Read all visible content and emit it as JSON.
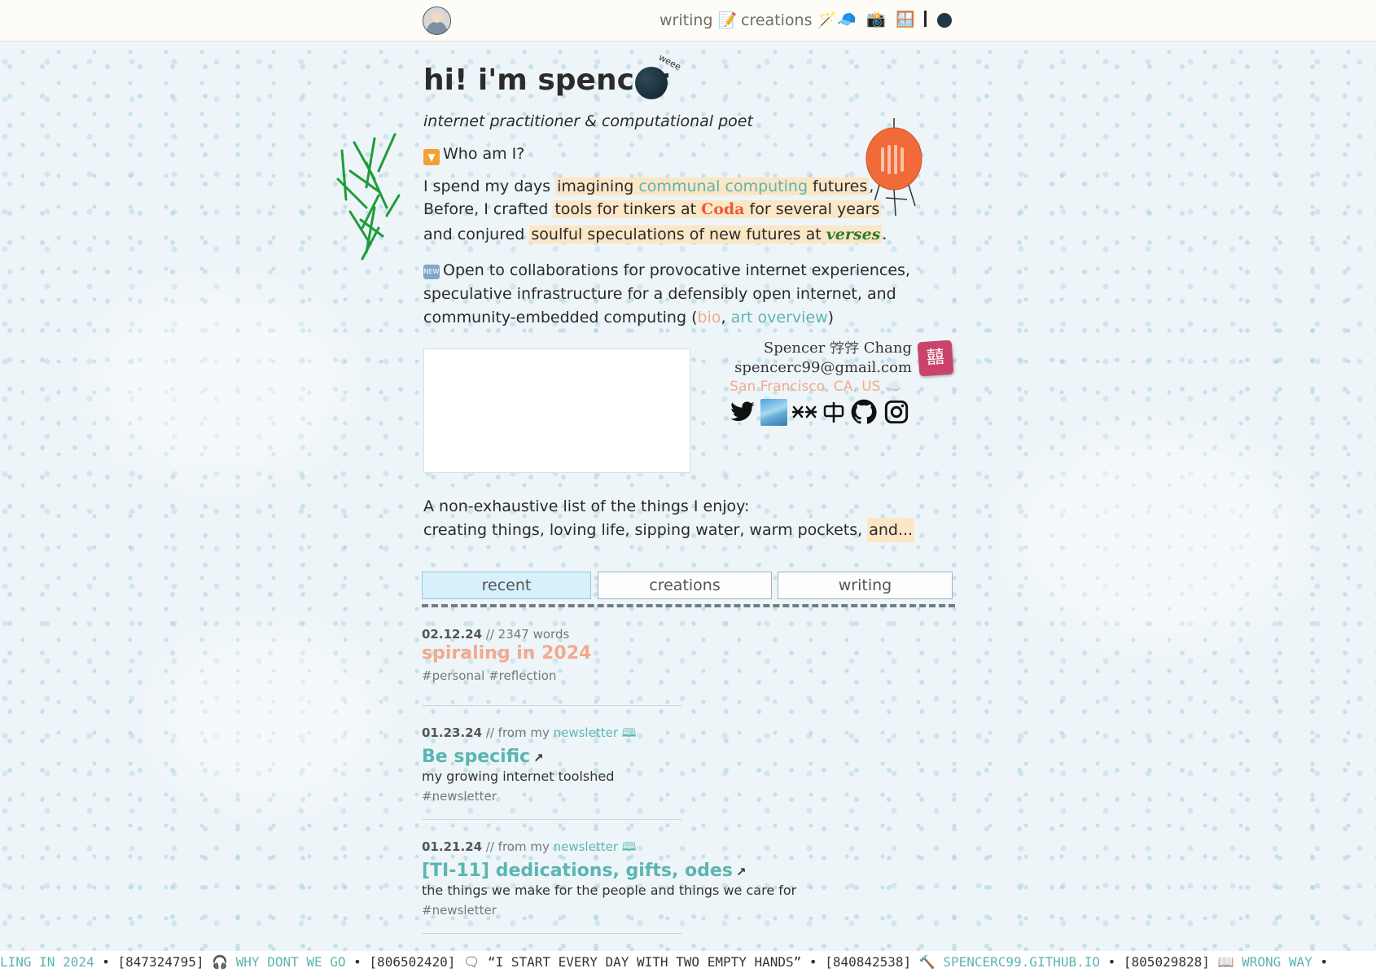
{
  "nav": {
    "writing": "writing 📝",
    "creations": "creations 🪄",
    "emoji_1": "🧢",
    "emoji_2": "📸",
    "emoji_3": "🪟"
  },
  "hero": {
    "title": "hi! i'm spencer",
    "moon_text": "weee",
    "subtitle": "internet practitioner & computational poet",
    "who_label": "Who am I?",
    "line1_a": "I spend my days ",
    "line1_b": "imagining ",
    "line1_link": "communal computing",
    "line1_c": " futures",
    "line1_d": ",",
    "line2_a": "Before, I crafted ",
    "line2_b": "tools for tinkers at ",
    "line2_coda": "Coda",
    "line2_c": " for several years",
    "line3_a": "and conjured ",
    "line3_b": "soulful speculations of new futures at ",
    "line3_verses": "verses",
    "line3_c": ".",
    "new_badge": "NEW",
    "collab_text": "Open to collaborations for provocative internet experiences, speculative infrastructure for a defensibly open internet, and community-embedded computing (",
    "collab_bio": "bio",
    "collab_sep": ", ",
    "collab_art": "art overview",
    "collab_end": ")"
  },
  "contact": {
    "name": "Spencer 𡨸𡨸 Chang",
    "email": "spencerc99@gmail.com",
    "location": "San Francisco, CA, US ☁️",
    "stamp_glyph": "囍"
  },
  "social": {
    "twitter": "twitter-icon",
    "image": "landscape-icon",
    "cosmos": "cosmos-icon",
    "newsletter": "newsletter-icon",
    "github": "github-icon",
    "instagram": "instagram-icon"
  },
  "enjoy": {
    "intro": "A non-exhaustive list of the things I enjoy:",
    "list": "creating things, loving life, sipping water, warm pockets, ",
    "more": "and..."
  },
  "tabs": [
    {
      "label": "recent",
      "active": true
    },
    {
      "label": "creations",
      "active": false
    },
    {
      "label": "writing",
      "active": false
    }
  ],
  "posts": [
    {
      "date": "02.12.24",
      "meta": " // 2347 words",
      "title": "spiraling in 2024",
      "desc": "",
      "tags": "#personal #reflection"
    },
    {
      "date": "01.23.24",
      "meta": " // from my ",
      "meta_link": "newsletter 🕮",
      "title": "Be specific",
      "desc": "my growing internet toolshed",
      "tags": "#newsletter"
    },
    {
      "date": "01.21.24",
      "meta": " // from my ",
      "meta_link": "newsletter 🕮",
      "title": "[TI-11] dedications, gifts, odes",
      "desc": "the things we make for the people and things we care for",
      "tags": "#newsletter"
    }
  ],
  "ticker": {
    "a": "LING IN 2024",
    "sep": " • ",
    "b": "[847324795] 🎧 ",
    "c": "WHY DONT WE GO",
    "d": "[806502420] 🗨 ",
    "e": "“I START EVERY DAY WITH TWO EMPTY HANDS”",
    "f": "[840842538] 🔨 ",
    "g": "SPENCERC99.GITHUB.IO",
    "h": "[805029828] 📖 ",
    "i": "WRONG WAY"
  },
  "colors": {
    "teal": "#5bb5b0",
    "orange_link": "#f4a98c",
    "highlight": "#fbe6c6",
    "active_tab": "#d6f1fb"
  }
}
